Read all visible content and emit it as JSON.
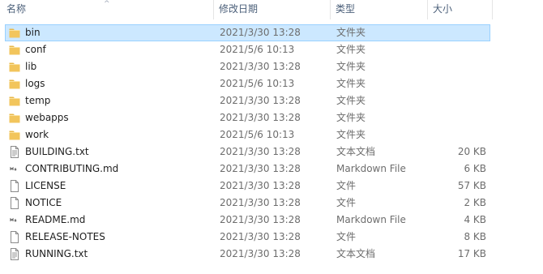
{
  "columns": {
    "name": "名称",
    "date": "修改日期",
    "type": "类型",
    "size": "大小"
  },
  "sort_indicator": "^",
  "colors": {
    "selection_bg": "#cce8ff",
    "selection_border": "#99d1ff",
    "folder": "#f2c55c",
    "header_text": "#4c607a",
    "meta_text": "#6d6d6d"
  },
  "files": [
    {
      "name": "bin",
      "date": "2021/3/30 13:28",
      "type": "文件夹",
      "size": "",
      "icon": "folder-icon",
      "selected": true
    },
    {
      "name": "conf",
      "date": "2021/5/6 10:13",
      "type": "文件夹",
      "size": "",
      "icon": "folder-icon"
    },
    {
      "name": "lib",
      "date": "2021/3/30 13:28",
      "type": "文件夹",
      "size": "",
      "icon": "folder-icon"
    },
    {
      "name": "logs",
      "date": "2021/5/6 10:13",
      "type": "文件夹",
      "size": "",
      "icon": "folder-icon"
    },
    {
      "name": "temp",
      "date": "2021/3/30 13:28",
      "type": "文件夹",
      "size": "",
      "icon": "folder-icon"
    },
    {
      "name": "webapps",
      "date": "2021/3/30 13:28",
      "type": "文件夹",
      "size": "",
      "icon": "folder-icon"
    },
    {
      "name": "work",
      "date": "2021/5/6 10:13",
      "type": "文件夹",
      "size": "",
      "icon": "folder-icon"
    },
    {
      "name": "BUILDING.txt",
      "date": "2021/3/30 13:28",
      "type": "文本文档",
      "size": "20 KB",
      "icon": "text-file-icon"
    },
    {
      "name": "CONTRIBUTING.md",
      "date": "2021/3/30 13:28",
      "type": "Markdown File",
      "size": "6 KB",
      "icon": "markdown-file-icon"
    },
    {
      "name": "LICENSE",
      "date": "2021/3/30 13:28",
      "type": "文件",
      "size": "57 KB",
      "icon": "blank-file-icon"
    },
    {
      "name": "NOTICE",
      "date": "2021/3/30 13:28",
      "type": "文件",
      "size": "2 KB",
      "icon": "blank-file-icon"
    },
    {
      "name": "README.md",
      "date": "2021/3/30 13:28",
      "type": "Markdown File",
      "size": "4 KB",
      "icon": "markdown-file-icon"
    },
    {
      "name": "RELEASE-NOTES",
      "date": "2021/3/30 13:28",
      "type": "文件",
      "size": "8 KB",
      "icon": "blank-file-icon"
    },
    {
      "name": "RUNNING.txt",
      "date": "2021/3/30 13:28",
      "type": "文本文档",
      "size": "17 KB",
      "icon": "text-file-icon"
    }
  ]
}
